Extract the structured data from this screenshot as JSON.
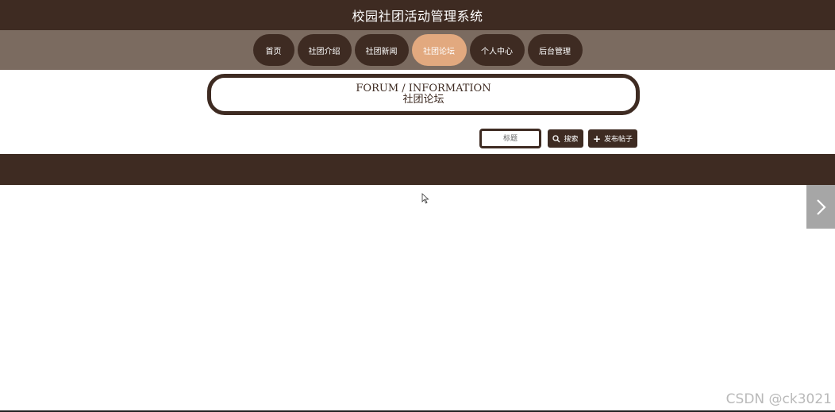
{
  "header": {
    "title": "校园社团活动管理系统"
  },
  "nav": {
    "items": [
      {
        "label": "首页"
      },
      {
        "label": "社团介绍"
      },
      {
        "label": "社团新闻"
      },
      {
        "label": "社团论坛",
        "active": true
      },
      {
        "label": "个人中心"
      },
      {
        "label": "后台管理"
      }
    ]
  },
  "section": {
    "title_en": "FORUM / INFORMATION",
    "title_zh": "社团论坛"
  },
  "search": {
    "placeholder": "标题",
    "search_label": "搜索",
    "post_label": "发布帖子"
  },
  "watermark": "CSDN @ck3021",
  "colors": {
    "primary": "#3e2b22",
    "nav_band": "#7b6b60",
    "active": "#e2a97f"
  }
}
